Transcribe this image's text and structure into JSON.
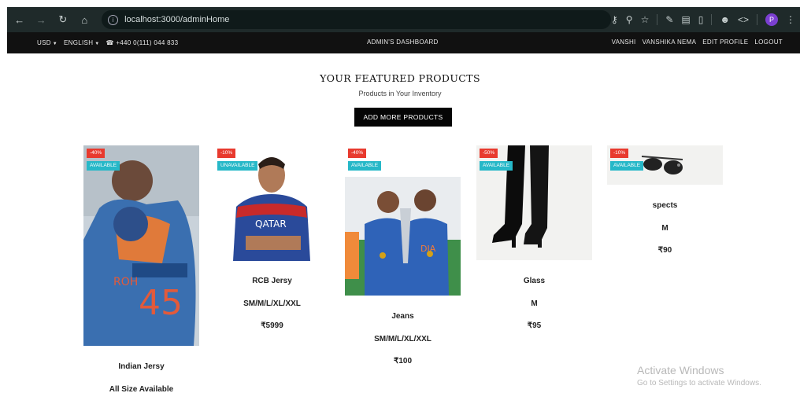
{
  "browser": {
    "url": "localhost:3000/adminHome",
    "profile_initial": "P"
  },
  "topbar": {
    "currency": "USD",
    "language": "ENGLISH",
    "phone": "+440 0(111) 044 833",
    "title": "ADMIN'S DASHBOARD",
    "username": "VANSHI",
    "fullname": "VANSHIKA NEMA",
    "edit_profile": "EDIT PROFILE",
    "logout": "LOGOUT"
  },
  "main": {
    "title": "YOUR FEATURED PRODUCTS",
    "subtitle": "Products in Your Inventory",
    "add_button": "ADD MORE PRODUCTS"
  },
  "products": [
    {
      "discount": "-40%",
      "status": "AVAILABLE",
      "name": "Indian Jersy",
      "size": "All Size Available",
      "price": ""
    },
    {
      "discount": "-10%",
      "status": "UNAVAILABLE",
      "name": "RCB Jersy",
      "size": "SM/M/L/XL/XXL",
      "price": "₹5999"
    },
    {
      "discount": "-40%",
      "status": "AVAILABLE",
      "name": "Jeans",
      "size": "SM/M/L/XL/XXL",
      "price": "₹100"
    },
    {
      "discount": "-50%",
      "status": "AVAILABLE",
      "name": "Glass",
      "size": "M",
      "price": "₹95"
    },
    {
      "discount": "-10%",
      "status": "AVAILABLE",
      "name": "spects",
      "size": "M",
      "price": "₹90"
    }
  ],
  "watermark": {
    "line1": "Activate Windows",
    "line2": "Go to Settings to activate Windows."
  },
  "colors": {
    "discount_badge": "#e83a2e",
    "available_badge": "#26b8c8",
    "topbar": "#111111"
  }
}
